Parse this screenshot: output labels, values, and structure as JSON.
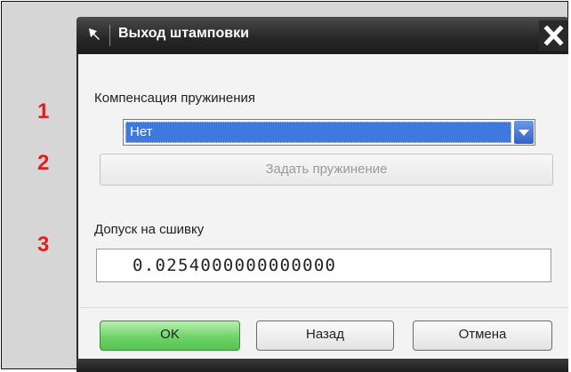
{
  "dialog": {
    "title": "Выход штамповки",
    "pin_icon": "pin-icon",
    "close_icon": "close-icon"
  },
  "markers": [
    "1",
    "2",
    "3"
  ],
  "springback": {
    "label": "Компенсация пружинения",
    "selected": "Нет",
    "dropdown_icon": "chevron-down-icon"
  },
  "set_springback_button": "Задать пружинение",
  "tolerance": {
    "label": "Допуск на сшивку",
    "value": "0.0254000000000000"
  },
  "buttons": {
    "ok": "OK",
    "back": "Назад",
    "cancel": "Отмена"
  },
  "colors": {
    "accent": "#3d79de",
    "ok_button": "#6fd268",
    "marker": "#e31e1e"
  }
}
